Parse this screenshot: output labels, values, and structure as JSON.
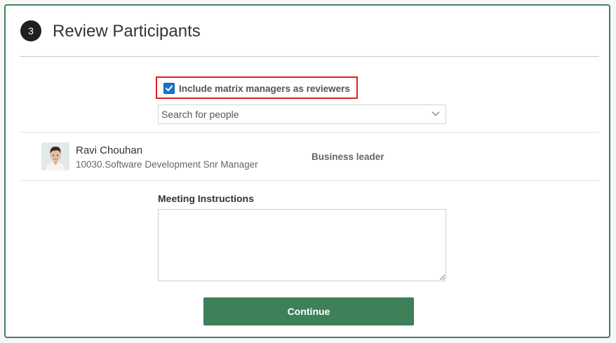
{
  "section": {
    "step_number": "3",
    "title": "Review Participants"
  },
  "options": {
    "include_matrix_managers_label": "Include matrix managers as reviewers",
    "include_matrix_managers_checked": true
  },
  "search": {
    "placeholder": "Search for people"
  },
  "participants": [
    {
      "name": "Ravi Chouhan",
      "title": "10030.Software Development Snr Manager",
      "role": "Business leader"
    }
  ],
  "meeting": {
    "label": "Meeting Instructions",
    "value": ""
  },
  "actions": {
    "continue_label": "Continue"
  },
  "colors": {
    "accent": "#3e8058",
    "checkbox": "#1a73c8",
    "highlight": "#e02020"
  }
}
